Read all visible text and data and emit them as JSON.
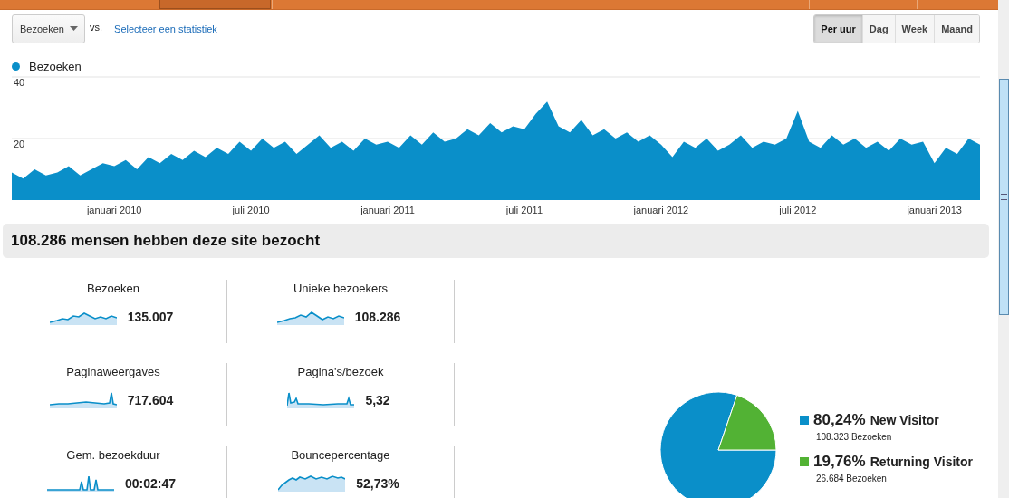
{
  "toolbar": {
    "metric_dropdown": {
      "value": "Bezoeken"
    },
    "vs_label": "vs.",
    "compare_link": "Selecteer een statistiek",
    "period_buttons": [
      {
        "label": "Per uur",
        "selected": true
      },
      {
        "label": "Dag",
        "selected": false
      },
      {
        "label": "Week",
        "selected": false
      },
      {
        "label": "Maand",
        "selected": false
      }
    ]
  },
  "visits_chart": {
    "chart_data": {
      "type": "area",
      "ylim": [
        0,
        40
      ],
      "yticks": [
        20,
        40
      ],
      "categories": [
        null,
        null,
        null,
        null,
        null,
        null,
        null,
        null,
        null,
        "januari 2010",
        null,
        null,
        null,
        null,
        null,
        null,
        null,
        null,
        null,
        null,
        null,
        "juli 2010",
        null,
        null,
        null,
        null,
        null,
        null,
        null,
        null,
        null,
        null,
        null,
        "januari 2011",
        null,
        null,
        null,
        null,
        null,
        null,
        null,
        null,
        null,
        null,
        null,
        "juli 2011",
        null,
        null,
        null,
        null,
        null,
        null,
        null,
        null,
        null,
        null,
        null,
        "januari 2012",
        null,
        null,
        null,
        null,
        null,
        null,
        null,
        null,
        null,
        null,
        null,
        "juli 2012",
        null,
        null,
        null,
        null,
        null,
        null,
        null,
        null,
        null,
        null,
        null,
        "januari 2013",
        null,
        null,
        null,
        null
      ],
      "series": [
        {
          "name": "Bezoeken",
          "color": "#0a8fc9",
          "values": [
            9,
            7,
            10,
            8,
            9,
            11,
            8,
            10,
            12,
            11,
            13,
            10,
            14,
            12,
            15,
            13,
            16,
            14,
            17,
            15,
            19,
            16,
            20,
            17,
            19,
            15,
            18,
            21,
            17,
            19,
            16,
            20,
            18,
            19,
            17,
            21,
            18,
            22,
            19,
            20,
            23,
            21,
            25,
            22,
            24,
            23,
            28,
            32,
            24,
            22,
            26,
            21,
            23,
            20,
            22,
            19,
            21,
            18,
            14,
            19,
            17,
            20,
            16,
            18,
            21,
            17,
            19,
            18,
            20,
            29,
            19,
            17,
            21,
            18,
            20,
            17,
            19,
            16,
            20,
            18,
            19,
            12,
            17,
            15,
            20,
            18
          ]
        }
      ]
    }
  },
  "summary_heading": "108.286 mensen hebben deze site bezocht",
  "metrics": [
    {
      "label": "Bezoeken",
      "value": "135.007"
    },
    {
      "label": "Unieke bezoekers",
      "value": "108.286"
    },
    {
      "label": "Paginaweergaves",
      "value": "717.604"
    },
    {
      "label": "Pagina's/bezoek",
      "value": "5,32"
    },
    {
      "label": "Gem. bezoekduur",
      "value": "00:02:47"
    },
    {
      "label": "Bouncepercentage",
      "value": "52,73%"
    }
  ],
  "visitor_pie": {
    "chart_data": {
      "type": "pie",
      "categories": [
        "New Visitor",
        "Returning Visitor"
      ],
      "series": [
        {
          "name": "Bezoeken",
          "values": [
            80.24,
            19.76
          ]
        }
      ]
    },
    "legend": [
      {
        "percent": "80,24%",
        "visits": "108.323",
        "color": "#0a8fc9"
      },
      {
        "percent": "19,76%",
        "visits": "26.684",
        "color": "#52b234"
      }
    ]
  }
}
